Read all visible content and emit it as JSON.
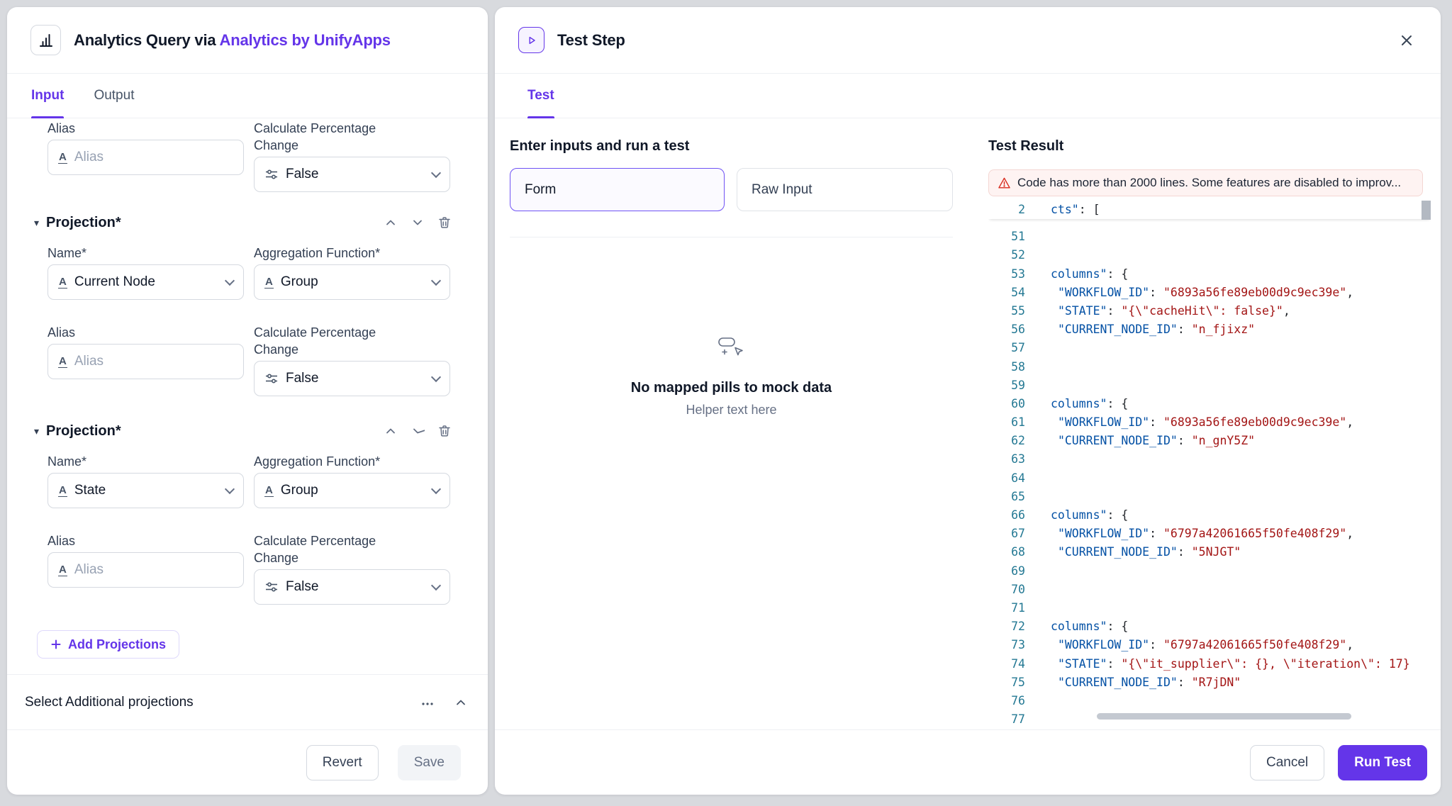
{
  "accent": "#6435E9",
  "left_panel": {
    "title_prefix": "Analytics Query via ",
    "title_brand": "Analytics by UnifyApps",
    "tabs": {
      "input": "Input",
      "output": "Output"
    },
    "labels": {
      "alias": "Alias",
      "alias_placeholder": "Alias",
      "calc_pct": "Calculate Percentage Change",
      "name": "Name*",
      "agg_fn": "Aggregation Function*",
      "projection": "Projection*",
      "false_value": "False"
    },
    "projections": [
      {
        "name_value": "Current Node",
        "agg_value": "Group"
      },
      {
        "name_value": "State",
        "agg_value": "Group"
      }
    ],
    "add_projections": "Add Projections",
    "select_additional": "Select Additional projections",
    "footer": {
      "revert": "Revert",
      "save": "Save"
    }
  },
  "right_panel": {
    "title": "Test Step",
    "tab": "Test",
    "inputs": {
      "heading": "Enter inputs and run a test",
      "form_toggle": "Form",
      "raw_toggle": "Raw Input",
      "empty_title": "No mapped pills to mock data",
      "empty_helper": "Helper text here"
    },
    "result": {
      "heading": "Test Result",
      "warning": "Code has more than 2000 lines. Some features are disabled to improv...",
      "sticky_line": {
        "n": "2",
        "parts": [
          [
            "key",
            "cts\""
          ],
          [
            "p",
            ": ["
          ]
        ]
      },
      "code_lines": [
        {
          "n": "51",
          "parts": []
        },
        {
          "n": "52",
          "parts": []
        },
        {
          "n": "53",
          "parts": [
            [
              "key",
              "columns\""
            ],
            [
              "p",
              ": {"
            ]
          ]
        },
        {
          "n": "54",
          "parts": [
            [
              "p",
              " "
            ],
            [
              "key",
              "\"WORKFLOW_ID\""
            ],
            [
              "p",
              ": "
            ],
            [
              "str",
              "\"6893a56fe89eb00d9c9ec39e\""
            ],
            [
              "p",
              ","
            ]
          ]
        },
        {
          "n": "55",
          "parts": [
            [
              "p",
              " "
            ],
            [
              "key",
              "\"STATE\""
            ],
            [
              "p",
              ": "
            ],
            [
              "str",
              "\"{\\\"cacheHit\\\": false}\""
            ],
            [
              "p",
              ","
            ]
          ]
        },
        {
          "n": "56",
          "parts": [
            [
              "p",
              " "
            ],
            [
              "key",
              "\"CURRENT_NODE_ID\""
            ],
            [
              "p",
              ": "
            ],
            [
              "str",
              "\"n_fjixz\""
            ]
          ]
        },
        {
          "n": "57",
          "parts": []
        },
        {
          "n": "58",
          "parts": []
        },
        {
          "n": "59",
          "parts": []
        },
        {
          "n": "60",
          "parts": [
            [
              "key",
              "columns\""
            ],
            [
              "p",
              ": {"
            ]
          ]
        },
        {
          "n": "61",
          "parts": [
            [
              "p",
              " "
            ],
            [
              "key",
              "\"WORKFLOW_ID\""
            ],
            [
              "p",
              ": "
            ],
            [
              "str",
              "\"6893a56fe89eb00d9c9ec39e\""
            ],
            [
              "p",
              ","
            ]
          ]
        },
        {
          "n": "62",
          "parts": [
            [
              "p",
              " "
            ],
            [
              "key",
              "\"CURRENT_NODE_ID\""
            ],
            [
              "p",
              ": "
            ],
            [
              "str",
              "\"n_gnY5Z\""
            ]
          ]
        },
        {
          "n": "63",
          "parts": []
        },
        {
          "n": "64",
          "parts": []
        },
        {
          "n": "65",
          "parts": []
        },
        {
          "n": "66",
          "parts": [
            [
              "key",
              "columns\""
            ],
            [
              "p",
              ": {"
            ]
          ]
        },
        {
          "n": "67",
          "parts": [
            [
              "p",
              " "
            ],
            [
              "key",
              "\"WORKFLOW_ID\""
            ],
            [
              "p",
              ": "
            ],
            [
              "str",
              "\"6797a42061665f50fe408f29\""
            ],
            [
              "p",
              ","
            ]
          ]
        },
        {
          "n": "68",
          "parts": [
            [
              "p",
              " "
            ],
            [
              "key",
              "\"CURRENT_NODE_ID\""
            ],
            [
              "p",
              ": "
            ],
            [
              "str",
              "\"5NJGT\""
            ]
          ]
        },
        {
          "n": "69",
          "parts": []
        },
        {
          "n": "70",
          "parts": []
        },
        {
          "n": "71",
          "parts": []
        },
        {
          "n": "72",
          "parts": [
            [
              "key",
              "columns\""
            ],
            [
              "p",
              ": {"
            ]
          ]
        },
        {
          "n": "73",
          "parts": [
            [
              "p",
              " "
            ],
            [
              "key",
              "\"WORKFLOW_ID\""
            ],
            [
              "p",
              ": "
            ],
            [
              "str",
              "\"6797a42061665f50fe408f29\""
            ],
            [
              "p",
              ","
            ]
          ]
        },
        {
          "n": "74",
          "parts": [
            [
              "p",
              " "
            ],
            [
              "key",
              "\"STATE\""
            ],
            [
              "p",
              ": "
            ],
            [
              "str",
              "\"{\\\"it_supplier\\\": {}, \\\"iteration\\\": 17}"
            ]
          ]
        },
        {
          "n": "75",
          "parts": [
            [
              "p",
              " "
            ],
            [
              "key",
              "\"CURRENT_NODE_ID\""
            ],
            [
              "p",
              ": "
            ],
            [
              "str",
              "\"R7jDN\""
            ]
          ]
        },
        {
          "n": "76",
          "parts": []
        },
        {
          "n": "77",
          "parts": []
        }
      ]
    },
    "footer": {
      "cancel": "Cancel",
      "run": "Run Test"
    }
  }
}
